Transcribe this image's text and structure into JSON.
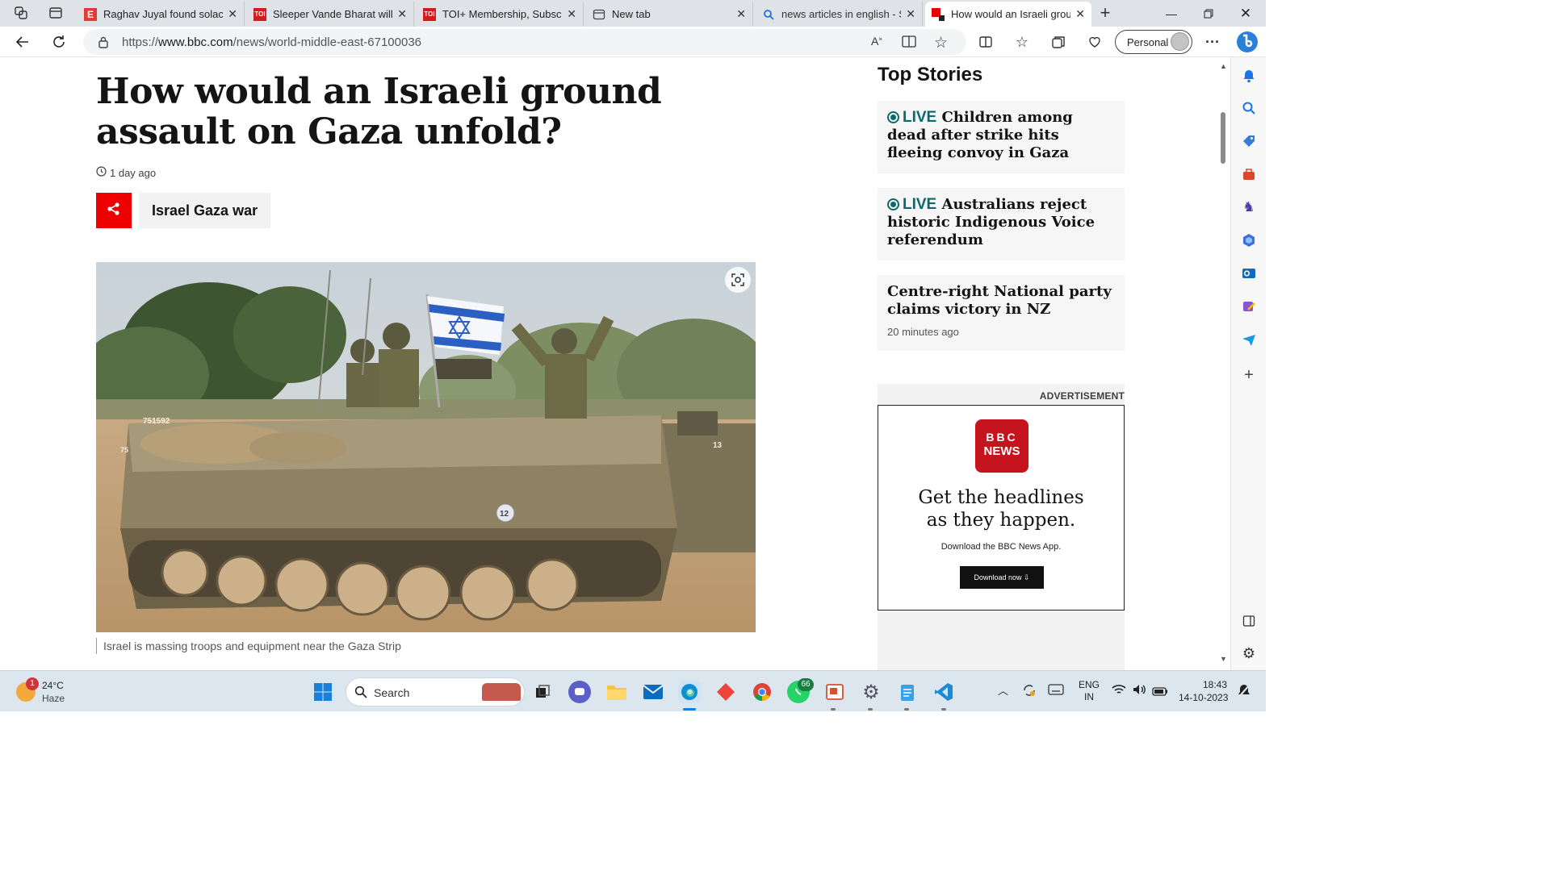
{
  "browser": {
    "tabs": [
      {
        "title": "Raghav Juyal found solace",
        "favicon": "E",
        "favicon_color": "#e53935",
        "active": false
      },
      {
        "title": "Sleeper Vande Bharat will c",
        "favicon": "TOI",
        "favicon_color": "#d71920",
        "active": false
      },
      {
        "title": "TOI+ Membership, Subscri",
        "favicon": "TOI",
        "favicon_color": "#d71920",
        "active": false
      },
      {
        "title": "New tab",
        "favicon": "newtab-icon",
        "favicon_color": "#444444",
        "active": false
      },
      {
        "title": "news articles in english - S",
        "favicon": "search-icon",
        "favicon_color": "#1a73e8",
        "active": false
      },
      {
        "title": "How would an Israeli grou",
        "favicon": "bbc-icon",
        "favicon_color": "#e60000",
        "active": true
      }
    ],
    "url_prefix": "https://",
    "url_domain": "www.bbc.com",
    "url_path": "/news/world-middle-east-67100036",
    "profile_label": "Personal"
  },
  "article": {
    "headline": "How would an Israeli ground assault on Gaza unfold?",
    "timestamp": "1 day ago",
    "topic_tag": "Israel Gaza war",
    "image_caption": "Israel is massing troops and equipment near the Gaza Strip",
    "vehicle_number": "751592",
    "vehicle_side_number": "75",
    "vehicle_marking": "12",
    "vehicle2_number": "13"
  },
  "top_stories": {
    "heading": "Top Stories",
    "stories": [
      {
        "live": "LIVE",
        "title": "Children among dead after strike hits fleeing convoy in Gaza",
        "time": ""
      },
      {
        "live": "LIVE",
        "title": "Australians reject historic Indigenous Voice referendum",
        "time": ""
      },
      {
        "live": "",
        "title": "Centre-right National party claims victory in NZ",
        "time": "20 minutes ago"
      }
    ]
  },
  "advertisement": {
    "label": "ADVERTISEMENT",
    "logo_top": "BBC",
    "logo_bottom": "NEWS",
    "headline_line1": "Get the headlines",
    "headline_line2": "as they happen.",
    "subtext": "Download the BBC News App.",
    "button": "Download now ⇩"
  },
  "taskbar": {
    "weather_temp": "24°C",
    "weather_desc": "Haze",
    "weather_badge": "1",
    "search_label": "Search",
    "whatsapp_badge": "66",
    "lang_top": "ENG",
    "lang_bottom": "IN",
    "time": "18:43",
    "date": "14-10-2023"
  },
  "colors": {
    "bbc_red": "#e60000",
    "live_teal": "#0a6a6b",
    "ad_red": "#c5141d"
  }
}
